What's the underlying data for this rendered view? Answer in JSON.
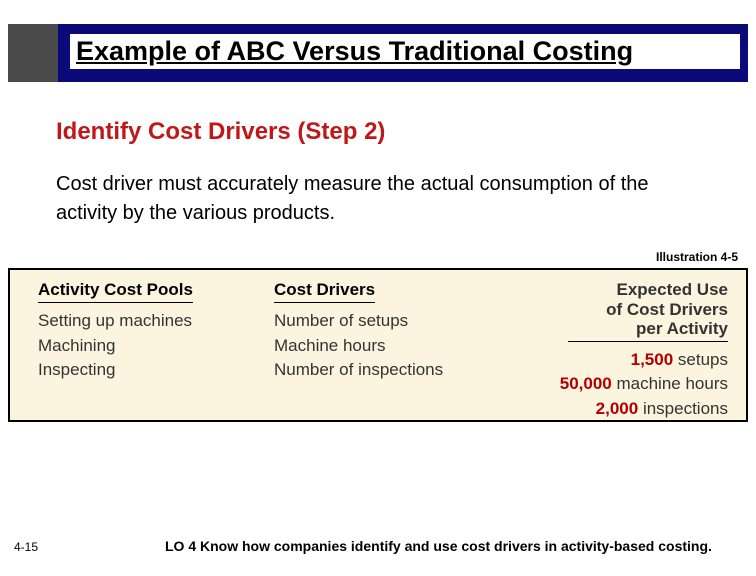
{
  "title": "Example of ABC Versus Traditional Costing",
  "subtitle": "Identify Cost Drivers (Step 2)",
  "body": "Cost driver must accurately measure the actual consumption of the activity by the various products.",
  "illustration_label": "Illustration 4-5",
  "table": {
    "headers": {
      "pools": "Activity Cost Pools",
      "drivers": "Cost Drivers",
      "expected_l1": "Expected Use",
      "expected_l2": "of Cost Drivers",
      "expected_l3": "per Activity"
    },
    "rows": [
      {
        "pool": "Setting up machines",
        "driver": "Number of setups",
        "value": "1,500",
        "unit": "setups"
      },
      {
        "pool": "Machining",
        "driver": "Machine hours",
        "value": "50,000",
        "unit": "machine hours"
      },
      {
        "pool": "Inspecting",
        "driver": "Number of inspections",
        "value": "2,000",
        "unit": "inspections"
      }
    ]
  },
  "footer": {
    "page": "4-15",
    "lo": "LO 4  Know how companies identify and use cost drivers in activity-based costing."
  }
}
